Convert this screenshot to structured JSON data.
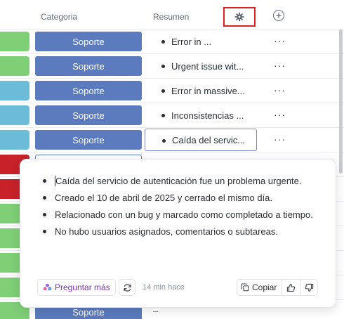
{
  "header": {
    "categoria_label": "Categoria",
    "resumen_label": "Resumen",
    "settings_icon": "gear-icon",
    "add_icon": "plus-circle-icon"
  },
  "colors": {
    "green": "#7fcf77",
    "teal": "#6bbcd6",
    "red": "#c7222a",
    "category": "#5b7bbe",
    "accent": "#7b2fc4"
  },
  "rows": [
    {
      "status_color": "#7fcf77",
      "category": "Soporte",
      "summary": "Error in ...",
      "more": "···"
    },
    {
      "status_color": "#7fcf77",
      "category": "Soporte",
      "summary": "Urgent issue wit...",
      "more": "···"
    },
    {
      "status_color": "#6bbcd6",
      "category": "Soporte",
      "summary": "Error in massive...",
      "more": "···"
    },
    {
      "status_color": "#6bbcd6",
      "category": "Soporte",
      "summary": "Inconsistencias ...",
      "more": "···"
    },
    {
      "status_color": "#6bbcd6",
      "category": "Soporte",
      "summary": "Caída del servic...",
      "more": "···"
    },
    {
      "status_color": "#c7222a",
      "category": "",
      "summary": "",
      "more": ""
    },
    {
      "status_color": "#c7222a",
      "category": "",
      "summary": "",
      "more": ""
    },
    {
      "status_color": "#7fcf77",
      "category": "",
      "summary": "",
      "more": ""
    },
    {
      "status_color": "#7fcf77",
      "category": "",
      "summary": "",
      "more": ""
    },
    {
      "status_color": "#7fcf77",
      "category": "",
      "summary": "",
      "more": ""
    },
    {
      "status_color": "#7fcf77",
      "category": "",
      "summary": "",
      "more": ""
    },
    {
      "status_color": "#7fcf77",
      "category": "Soporte",
      "summary": "–",
      "more": ""
    }
  ],
  "popup": {
    "bullets": [
      "Caída del servicio de autenticación fue un problema urgente.",
      "Creado el 10 de abril de 2025 y cerrado el mismo día.",
      "Relacionado con un bug y marcado como completado a tiempo.",
      "No hubo usuarios asignados, comentarios o subtareas."
    ],
    "ask_label": "Preguntar más",
    "time": "14 min hace",
    "copy_label": "Copiar"
  }
}
